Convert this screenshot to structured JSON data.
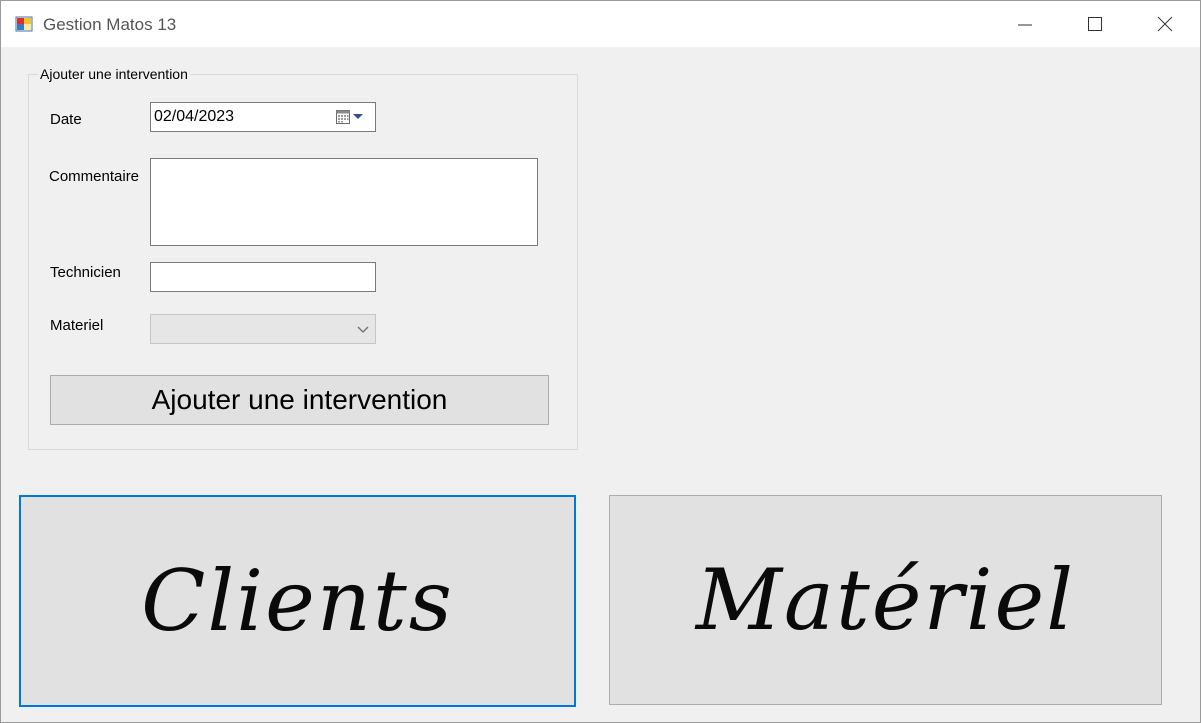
{
  "window": {
    "title": "Gestion Matos 13"
  },
  "form": {
    "group_title": "Ajouter une intervention",
    "date_label": "Date",
    "date_value": "02/04/2023",
    "comment_label": "Commentaire",
    "comment_value": "",
    "technician_label": "Technicien",
    "technician_value": "",
    "material_label": "Materiel",
    "material_selected": "",
    "submit_label": "Ajouter une intervention"
  },
  "nav": {
    "clients_label": "Clients",
    "materiel_label": "Matériel"
  },
  "colors": {
    "window_bg": "#f0f0f0",
    "focus_border": "#0078d7",
    "button_bg": "#e1e1e1"
  },
  "icons": [
    "app-icon",
    "minimize-icon",
    "maximize-icon",
    "close-icon",
    "calendar-icon",
    "chevron-down-icon"
  ]
}
